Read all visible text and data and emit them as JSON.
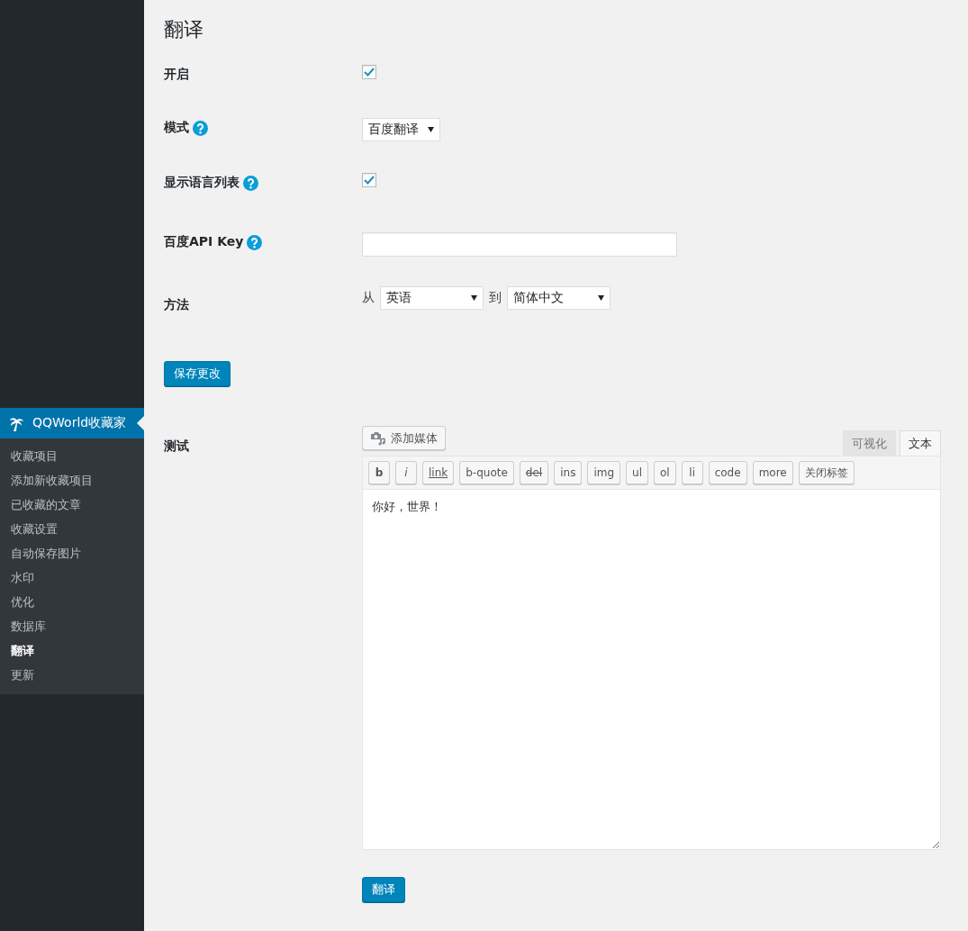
{
  "sidebar": {
    "menu_title": "QQWorld收藏家",
    "items": [
      {
        "label": "收藏项目",
        "selected": false
      },
      {
        "label": "添加新收藏项目",
        "selected": false
      },
      {
        "label": "已收藏的文章",
        "selected": false
      },
      {
        "label": "收藏设置",
        "selected": false
      },
      {
        "label": "自动保存图片",
        "selected": false
      },
      {
        "label": "水印",
        "selected": false
      },
      {
        "label": "优化",
        "selected": false
      },
      {
        "label": "数据库",
        "selected": false
      },
      {
        "label": "翻译",
        "selected": true
      },
      {
        "label": "更新",
        "selected": false
      }
    ]
  },
  "page_title": "翻译",
  "settings": [
    {
      "kind": "checkbox",
      "label": "开启",
      "help": false,
      "checked": true
    },
    {
      "kind": "select",
      "label": "模式",
      "help": true,
      "value": "百度翻译"
    },
    {
      "kind": "checkbox",
      "label": "显示语言列表",
      "help": true,
      "checked": true
    },
    {
      "kind": "text",
      "label": "百度API Key",
      "help": true
    },
    {
      "kind": "direction",
      "label": "方法",
      "help": false,
      "from_label": "从",
      "from_value": "英语",
      "to_label": "到",
      "to_value": "简体中文"
    }
  ],
  "save_button": "保存更改",
  "test": {
    "label": "测试",
    "add_media": "添加媒体",
    "tabs": [
      {
        "label": "可视化",
        "selected": false
      },
      {
        "label": "文本",
        "selected": true
      }
    ],
    "quicktags": [
      {
        "label": "b",
        "kind": "bold"
      },
      {
        "label": "i",
        "kind": "italic"
      },
      {
        "label": "link",
        "kind": "underline"
      },
      {
        "label": "b-quote",
        "kind": "plain"
      },
      {
        "label": "del",
        "kind": "strike"
      },
      {
        "label": "ins",
        "kind": "plain"
      },
      {
        "label": "img",
        "kind": "plain"
      },
      {
        "label": "ul",
        "kind": "plain"
      },
      {
        "label": "ol",
        "kind": "plain"
      },
      {
        "label": "li",
        "kind": "plain"
      },
      {
        "label": "code",
        "kind": "plain"
      },
      {
        "label": "more",
        "kind": "plain"
      },
      {
        "label": "关闭标签",
        "kind": "plain"
      }
    ],
    "content": "你好，世界！",
    "translate_button": "翻译"
  }
}
